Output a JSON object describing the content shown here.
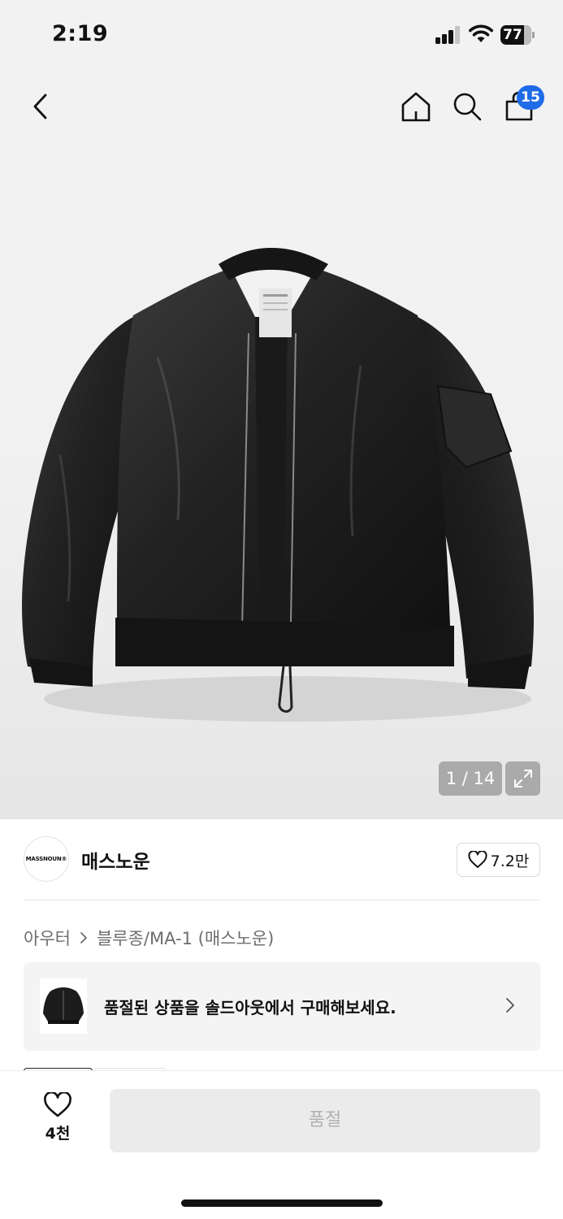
{
  "status_bar": {
    "time": "2:19",
    "battery_level": "77"
  },
  "nav": {
    "cart_count": "15",
    "icons": [
      "back-chevron-icon",
      "home-icon",
      "search-icon",
      "shopping-bag-icon"
    ]
  },
  "gallery": {
    "counter": "1 / 14",
    "current_image": "black nylon bomber jacket"
  },
  "brand": {
    "logo_text": "MASSNOUN®",
    "name": "매스노운",
    "like_count": "7.2만"
  },
  "breadcrumb": {
    "category": "아우터",
    "subcategory": "블루종/MA-1 (매스노운)"
  },
  "soldout_banner": {
    "text": "품절된 상품을 솔드아웃에서 구매해보세요."
  },
  "bottom_bar": {
    "wish_count": "4천",
    "buy_label": "품절"
  },
  "colors": {
    "badge": "#1f6be8",
    "disabled_button_bg": "#ebebeb",
    "disabled_button_text": "#b2b2b2"
  }
}
